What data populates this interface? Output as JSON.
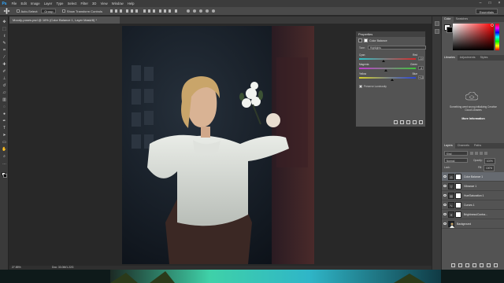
{
  "menu": {
    "app_icon": "Ps",
    "items": [
      "File",
      "Edit",
      "Image",
      "Layer",
      "Type",
      "Select",
      "Filter",
      "3D",
      "View",
      "Window",
      "Help"
    ],
    "window_buttons": [
      "–",
      "□",
      "×"
    ]
  },
  "options_bar": {
    "auto_select_label": "Auto-Select:",
    "auto_select_target": "Group",
    "show_transform_label": "Show Transform Controls",
    "workspace": "Essentials"
  },
  "document": {
    "tab_title": "Moody-poses.psd @ 16% (Color Balance 1, Layer Mask/8) *",
    "zoom": "27.85%",
    "doc_size": "Doc: 33.0M/1.22G"
  },
  "properties": {
    "panel_title": "Properties",
    "section_label": "Color Balance",
    "tone_label": "Tone:",
    "tone_value": "Highlights",
    "sliders": [
      {
        "left": "Cyan",
        "right": "Red",
        "value": "-10",
        "level": 0.43,
        "gradient": [
          "#2ec4c9",
          "#d62a2a"
        ]
      },
      {
        "left": "Magenta",
        "right": "Green",
        "value": "-4",
        "level": 0.47,
        "gradient": [
          "#c23bd0",
          "#3ec43a"
        ]
      },
      {
        "left": "Yellow",
        "right": "Blue",
        "value": "+13",
        "level": 0.59,
        "gradient": [
          "#d6cf2a",
          "#2b45d6"
        ]
      }
    ],
    "preserve_luminosity_label": "Preserve Luminosity",
    "preserve_luminosity_checked": true,
    "footer_icons": [
      "clip-icon",
      "view-previous-icon",
      "reset-icon",
      "visibility-icon",
      "trash-icon"
    ]
  },
  "color_panel": {
    "tabs": [
      "Color",
      "Swatches"
    ],
    "hue_colors": [
      "#ff0000",
      "#ff00ff",
      "#0000ff",
      "#00ffff",
      "#00ff00",
      "#ffff00",
      "#ff0000"
    ],
    "base_color": "#ff0000"
  },
  "libraries_panel": {
    "tabs": [
      "Libraries",
      "Adjustments",
      "Styles"
    ],
    "message": "Something went wrong initializing Creative Cloud Libraries",
    "more_link": "More Information"
  },
  "layers_panel": {
    "tabs": [
      "Layers",
      "Channels",
      "Paths"
    ],
    "kind_label": "Kind",
    "blend_mode": "Normal",
    "opacity_label": "Opacity:",
    "opacity": "100%",
    "lock_label": "Lock:",
    "fill_label": "Fill:",
    "fill": "100%",
    "layers": [
      {
        "name": "Color Balance 1",
        "icon": "scale-icon",
        "selected": true,
        "has_mask": true
      },
      {
        "name": "Vibrance 1",
        "icon": "triangle-icon",
        "selected": false,
        "has_mask": true
      },
      {
        "name": "Hue/Saturation 1",
        "icon": "levels-icon",
        "selected": false,
        "has_mask": true
      },
      {
        "name": "Curves 1",
        "icon": "curve-icon",
        "selected": false,
        "has_mask": true
      },
      {
        "name": "Brightness/Contra...",
        "icon": "sun-icon",
        "selected": false,
        "has_mask": true
      },
      {
        "name": "Background",
        "icon": "image-icon",
        "selected": false,
        "has_mask": false
      }
    ],
    "footer_icons": [
      "link-icon",
      "fx-icon",
      "mask-icon",
      "adjustment-icon",
      "folder-icon",
      "new-layer-icon",
      "trash-icon"
    ]
  },
  "tools": [
    "move-icon",
    "marquee-icon",
    "lasso-icon",
    "quick-select-icon",
    "crop-icon",
    "eyedropper-icon",
    "healing-icon",
    "brush-icon",
    "stamp-icon",
    "history-brush-icon",
    "eraser-icon",
    "gradient-icon",
    "blur-icon",
    "dodge-icon",
    "pen-icon",
    "type-icon",
    "path-select-icon",
    "shape-icon",
    "hand-icon",
    "zoom-icon",
    "more-icon"
  ],
  "colors": {
    "accent": "#31a8ff",
    "panel": "#535353",
    "dark": "#282828"
  }
}
